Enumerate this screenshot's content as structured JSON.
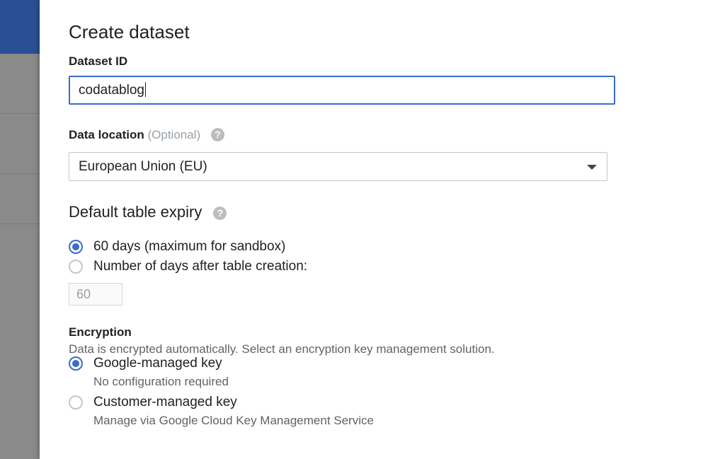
{
  "dialog": {
    "title": "Create dataset"
  },
  "dataset_id": {
    "label": "Dataset ID",
    "value": "codatablog"
  },
  "data_location": {
    "label": "Data location",
    "optional": "(Optional)",
    "selected": "European Union (EU)"
  },
  "table_expiry": {
    "title": "Default table expiry",
    "options": [
      {
        "label": "60 days (maximum for sandbox)",
        "checked": true
      },
      {
        "label": "Number of days after table creation:",
        "checked": false
      }
    ],
    "days_value": "60"
  },
  "encryption": {
    "label": "Encryption",
    "description": "Data is encrypted automatically. Select an encryption key management solution.",
    "options": [
      {
        "label": "Google-managed key",
        "sub": "No configuration required",
        "checked": true
      },
      {
        "label": "Customer-managed key",
        "sub": "Manage via Google Cloud Key Management Service",
        "checked": false
      }
    ]
  },
  "icons": {
    "help": "?"
  },
  "colors": {
    "accent": "#3a6bd1",
    "backdrop_header": "#2a4f92",
    "backdrop": "#8a8a8a"
  }
}
